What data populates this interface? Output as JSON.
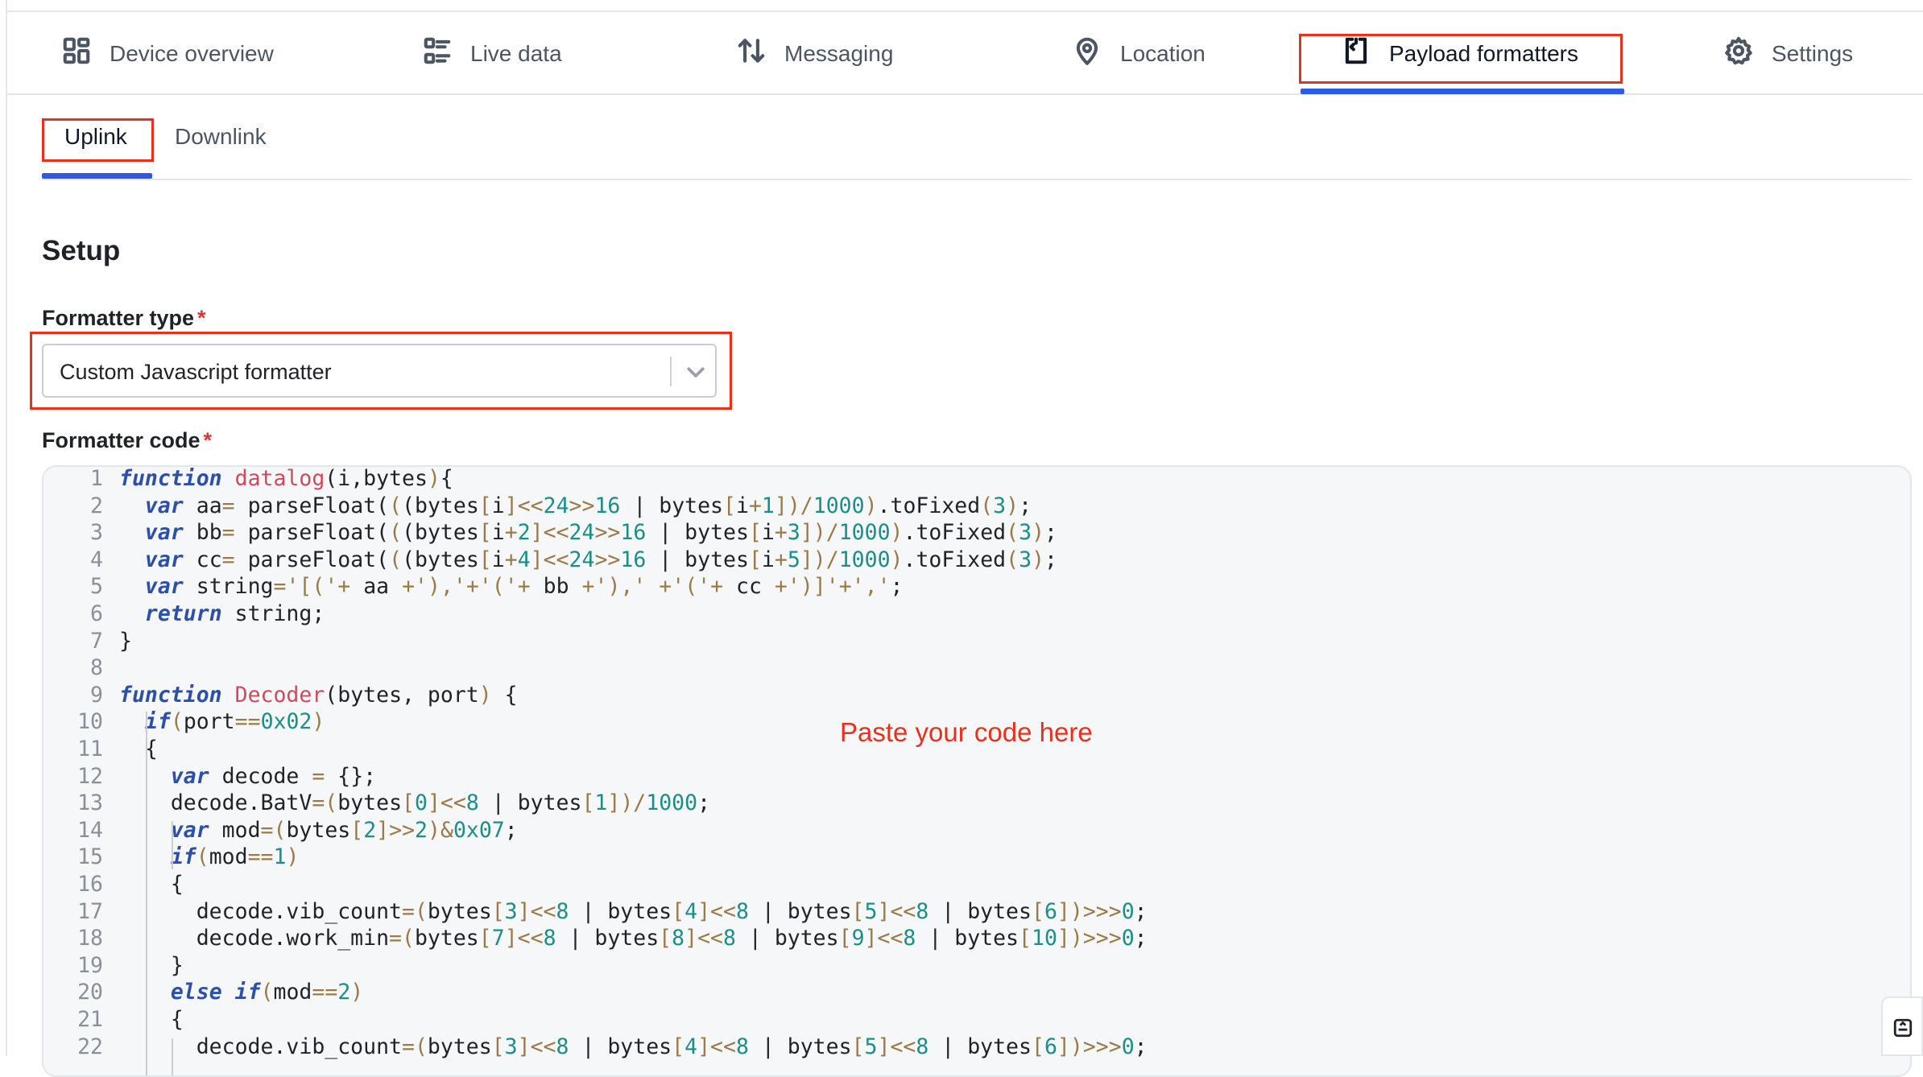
{
  "tabs": {
    "device_overview": "Device overview",
    "live_data": "Live data",
    "messaging": "Messaging",
    "location": "Location",
    "payload_formatters": "Payload formatters",
    "settings": "Settings"
  },
  "subtabs": {
    "uplink": "Uplink",
    "downlink": "Downlink"
  },
  "setup": {
    "heading": "Setup",
    "formatter_type_label": "Formatter type",
    "formatter_type_value": "Custom Javascript formatter",
    "formatter_code_label": "Formatter code",
    "required_mark": "*"
  },
  "hint": "Paste your code here",
  "code_lines": [
    {
      "n": "1",
      "segs": [
        [
          "kw",
          "function"
        ],
        [
          "p",
          " "
        ],
        [
          "fn",
          "datalog"
        ],
        [
          "p",
          "(i,bytes"
        ],
        [
          "op",
          ")"
        ],
        [
          "p",
          "{"
        ]
      ]
    },
    {
      "n": "2",
      "segs": [
        [
          "p",
          "  "
        ],
        [
          "kw",
          "var"
        ],
        [
          "p",
          " aa"
        ],
        [
          "op",
          "="
        ],
        [
          "p",
          " parseFloat("
        ],
        [
          "op",
          "("
        ],
        [
          "p",
          "(bytes"
        ],
        [
          "op",
          "["
        ],
        [
          "p",
          "i"
        ],
        [
          "op",
          "]<<"
        ],
        [
          "num",
          "24"
        ],
        [
          "op",
          ">>"
        ],
        [
          "num",
          "16"
        ],
        [
          "p",
          " | bytes"
        ],
        [
          "op",
          "["
        ],
        [
          "p",
          "i"
        ],
        [
          "op",
          "+"
        ],
        [
          "num",
          "1"
        ],
        [
          "op",
          "])/"
        ],
        [
          "num",
          "1000"
        ],
        [
          "op",
          ")"
        ],
        [
          "p",
          ".toFixed"
        ],
        [
          "op",
          "("
        ],
        [
          "num",
          "3"
        ],
        [
          "op",
          ")"
        ],
        [
          "p",
          ";"
        ]
      ]
    },
    {
      "n": "3",
      "segs": [
        [
          "p",
          "  "
        ],
        [
          "kw",
          "var"
        ],
        [
          "p",
          " bb"
        ],
        [
          "op",
          "="
        ],
        [
          "p",
          " parseFloat("
        ],
        [
          "op",
          "("
        ],
        [
          "p",
          "(bytes"
        ],
        [
          "op",
          "["
        ],
        [
          "p",
          "i"
        ],
        [
          "op",
          "+"
        ],
        [
          "num",
          "2"
        ],
        [
          "op",
          "]<<"
        ],
        [
          "num",
          "24"
        ],
        [
          "op",
          ">>"
        ],
        [
          "num",
          "16"
        ],
        [
          "p",
          " | bytes"
        ],
        [
          "op",
          "["
        ],
        [
          "p",
          "i"
        ],
        [
          "op",
          "+"
        ],
        [
          "num",
          "3"
        ],
        [
          "op",
          "])/"
        ],
        [
          "num",
          "1000"
        ],
        [
          "op",
          ")"
        ],
        [
          "p",
          ".toFixed"
        ],
        [
          "op",
          "("
        ],
        [
          "num",
          "3"
        ],
        [
          "op",
          ")"
        ],
        [
          "p",
          ";"
        ]
      ]
    },
    {
      "n": "4",
      "segs": [
        [
          "p",
          "  "
        ],
        [
          "kw",
          "var"
        ],
        [
          "p",
          " cc"
        ],
        [
          "op",
          "="
        ],
        [
          "p",
          " parseFloat("
        ],
        [
          "op",
          "("
        ],
        [
          "p",
          "(bytes"
        ],
        [
          "op",
          "["
        ],
        [
          "p",
          "i"
        ],
        [
          "op",
          "+"
        ],
        [
          "num",
          "4"
        ],
        [
          "op",
          "]<<"
        ],
        [
          "num",
          "24"
        ],
        [
          "op",
          ">>"
        ],
        [
          "num",
          "16"
        ],
        [
          "p",
          " | bytes"
        ],
        [
          "op",
          "["
        ],
        [
          "p",
          "i"
        ],
        [
          "op",
          "+"
        ],
        [
          "num",
          "5"
        ],
        [
          "op",
          "])/"
        ],
        [
          "num",
          "1000"
        ],
        [
          "op",
          ")"
        ],
        [
          "p",
          ".toFixed"
        ],
        [
          "op",
          "("
        ],
        [
          "num",
          "3"
        ],
        [
          "op",
          ")"
        ],
        [
          "p",
          ";"
        ]
      ]
    },
    {
      "n": "5",
      "segs": [
        [
          "p",
          "  "
        ],
        [
          "kw",
          "var"
        ],
        [
          "p",
          " string"
        ],
        [
          "op",
          "="
        ],
        [
          "str",
          "'[('"
        ],
        [
          "op",
          "+"
        ],
        [
          "p",
          " aa "
        ],
        [
          "op",
          "+"
        ],
        [
          "str",
          "'),'"
        ],
        [
          "op",
          "+"
        ],
        [
          "str",
          "'('"
        ],
        [
          "op",
          "+"
        ],
        [
          "p",
          " bb "
        ],
        [
          "op",
          "+"
        ],
        [
          "str",
          "'),' "
        ],
        [
          "op",
          "+"
        ],
        [
          "str",
          "'('"
        ],
        [
          "op",
          "+"
        ],
        [
          "p",
          " cc "
        ],
        [
          "op",
          "+"
        ],
        [
          "str",
          "')]'"
        ],
        [
          "op",
          "+"
        ],
        [
          "str",
          "','"
        ],
        [
          "p",
          ";"
        ]
      ]
    },
    {
      "n": "6",
      "segs": [
        [
          "p",
          "  "
        ],
        [
          "kw",
          "return"
        ],
        [
          "p",
          " string;"
        ]
      ]
    },
    {
      "n": "7",
      "segs": [
        [
          "p",
          "}"
        ]
      ]
    },
    {
      "n": "8",
      "segs": []
    },
    {
      "n": "9",
      "segs": [
        [
          "kw",
          "function"
        ],
        [
          "p",
          " "
        ],
        [
          "fn",
          "Decoder"
        ],
        [
          "p",
          "(bytes, port"
        ],
        [
          "op",
          ")"
        ],
        [
          "p",
          " {"
        ]
      ]
    },
    {
      "n": "10",
      "segs": [
        [
          "p",
          "  "
        ],
        [
          "kw",
          "if"
        ],
        [
          "op",
          "("
        ],
        [
          "p",
          "port"
        ],
        [
          "op",
          "=="
        ],
        [
          "num",
          "0x02"
        ],
        [
          "op",
          ")"
        ]
      ]
    },
    {
      "n": "11",
      "segs": [
        [
          "p",
          "  {"
        ]
      ]
    },
    {
      "n": "12",
      "segs": [
        [
          "p",
          "    "
        ],
        [
          "kw",
          "var"
        ],
        [
          "p",
          " decode "
        ],
        [
          "op",
          "="
        ],
        [
          "p",
          " {};"
        ]
      ]
    },
    {
      "n": "13",
      "segs": [
        [
          "p",
          "    decode.BatV"
        ],
        [
          "op",
          "=("
        ],
        [
          "p",
          "bytes"
        ],
        [
          "op",
          "["
        ],
        [
          "num",
          "0"
        ],
        [
          "op",
          "]<<"
        ],
        [
          "num",
          "8"
        ],
        [
          "p",
          " | bytes"
        ],
        [
          "op",
          "["
        ],
        [
          "num",
          "1"
        ],
        [
          "op",
          "])/"
        ],
        [
          "num",
          "1000"
        ],
        [
          "p",
          ";"
        ]
      ]
    },
    {
      "n": "14",
      "segs": [
        [
          "p",
          "    "
        ],
        [
          "kw",
          "var"
        ],
        [
          "p",
          " mod"
        ],
        [
          "op",
          "=("
        ],
        [
          "p",
          "bytes"
        ],
        [
          "op",
          "["
        ],
        [
          "num",
          "2"
        ],
        [
          "op",
          "]>>"
        ],
        [
          "num",
          "2"
        ],
        [
          "op",
          ")&"
        ],
        [
          "num",
          "0x07"
        ],
        [
          "p",
          ";"
        ]
      ]
    },
    {
      "n": "15",
      "segs": [
        [
          "p",
          "    "
        ],
        [
          "kw",
          "if"
        ],
        [
          "op",
          "("
        ],
        [
          "p",
          "mod"
        ],
        [
          "op",
          "=="
        ],
        [
          "num",
          "1"
        ],
        [
          "op",
          ")"
        ]
      ]
    },
    {
      "n": "16",
      "segs": [
        [
          "p",
          "    {"
        ]
      ]
    },
    {
      "n": "17",
      "segs": [
        [
          "p",
          "      decode.vib_count"
        ],
        [
          "op",
          "=("
        ],
        [
          "p",
          "bytes"
        ],
        [
          "op",
          "["
        ],
        [
          "num",
          "3"
        ],
        [
          "op",
          "]<<"
        ],
        [
          "num",
          "8"
        ],
        [
          "p",
          " | bytes"
        ],
        [
          "op",
          "["
        ],
        [
          "num",
          "4"
        ],
        [
          "op",
          "]<<"
        ],
        [
          "num",
          "8"
        ],
        [
          "p",
          " | bytes"
        ],
        [
          "op",
          "["
        ],
        [
          "num",
          "5"
        ],
        [
          "op",
          "]<<"
        ],
        [
          "num",
          "8"
        ],
        [
          "p",
          " | bytes"
        ],
        [
          "op",
          "["
        ],
        [
          "num",
          "6"
        ],
        [
          "op",
          "])>>>"
        ],
        [
          "num",
          "0"
        ],
        [
          "p",
          ";"
        ]
      ]
    },
    {
      "n": "18",
      "segs": [
        [
          "p",
          "      decode.work_min"
        ],
        [
          "op",
          "=("
        ],
        [
          "p",
          "bytes"
        ],
        [
          "op",
          "["
        ],
        [
          "num",
          "7"
        ],
        [
          "op",
          "]<<"
        ],
        [
          "num",
          "8"
        ],
        [
          "p",
          " | bytes"
        ],
        [
          "op",
          "["
        ],
        [
          "num",
          "8"
        ],
        [
          "op",
          "]<<"
        ],
        [
          "num",
          "8"
        ],
        [
          "p",
          " | bytes"
        ],
        [
          "op",
          "["
        ],
        [
          "num",
          "9"
        ],
        [
          "op",
          "]<<"
        ],
        [
          "num",
          "8"
        ],
        [
          "p",
          " | bytes"
        ],
        [
          "op",
          "["
        ],
        [
          "num",
          "10"
        ],
        [
          "op",
          "])>>>"
        ],
        [
          "num",
          "0"
        ],
        [
          "p",
          ";"
        ]
      ]
    },
    {
      "n": "19",
      "segs": [
        [
          "p",
          "    }"
        ]
      ]
    },
    {
      "n": "20",
      "segs": [
        [
          "p",
          "    "
        ],
        [
          "kw",
          "else"
        ],
        [
          "p",
          " "
        ],
        [
          "kw",
          "if"
        ],
        [
          "op",
          "("
        ],
        [
          "p",
          "mod"
        ],
        [
          "op",
          "=="
        ],
        [
          "num",
          "2"
        ],
        [
          "op",
          ")"
        ]
      ]
    },
    {
      "n": "21",
      "segs": [
        [
          "p",
          "    {"
        ]
      ]
    },
    {
      "n": "22",
      "segs": [
        [
          "p",
          "      decode.vib_count"
        ],
        [
          "op",
          "=("
        ],
        [
          "p",
          "bytes"
        ],
        [
          "op",
          "["
        ],
        [
          "num",
          "3"
        ],
        [
          "op",
          "]<<"
        ],
        [
          "num",
          "8"
        ],
        [
          "p",
          " | bytes"
        ],
        [
          "op",
          "["
        ],
        [
          "num",
          "4"
        ],
        [
          "op",
          "]<<"
        ],
        [
          "num",
          "8"
        ],
        [
          "p",
          " | bytes"
        ],
        [
          "op",
          "["
        ],
        [
          "num",
          "5"
        ],
        [
          "op",
          "]<<"
        ],
        [
          "num",
          "8"
        ],
        [
          "p",
          " | bytes"
        ],
        [
          "op",
          "["
        ],
        [
          "num",
          "6"
        ],
        [
          "op",
          "])>>>"
        ],
        [
          "num",
          "0"
        ],
        [
          "p",
          ";"
        ]
      ]
    }
  ]
}
